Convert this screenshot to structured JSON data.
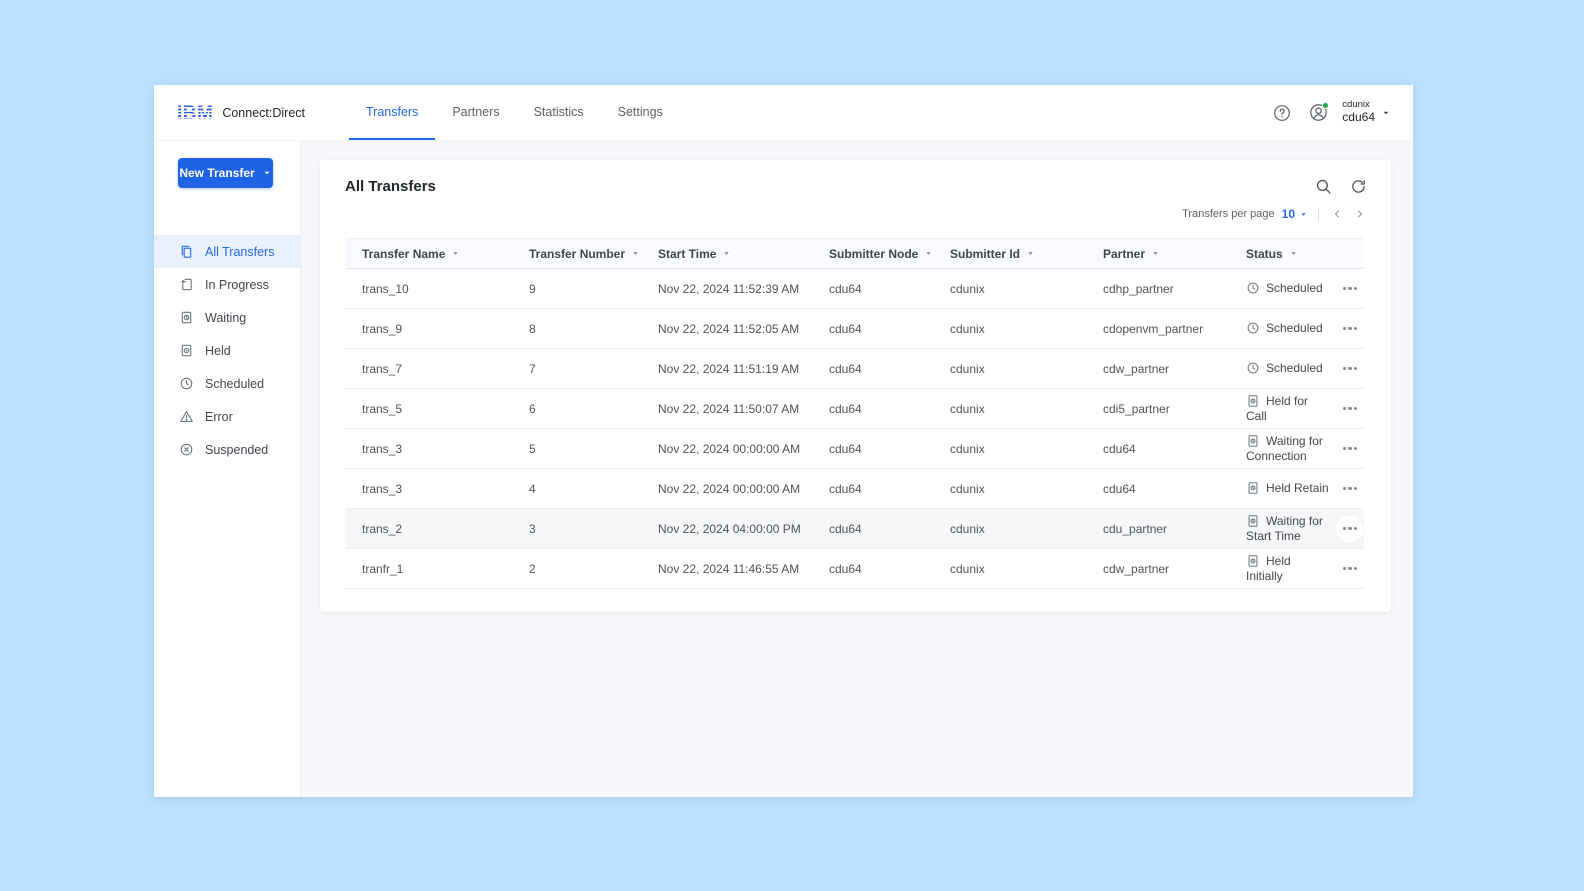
{
  "app": {
    "brand": {
      "logo": "IBM",
      "product": "Connect:Direct"
    },
    "nav_tabs": [
      {
        "label": "Transfers",
        "active": true
      },
      {
        "label": "Partners",
        "active": false
      },
      {
        "label": "Statistics",
        "active": false
      },
      {
        "label": "Settings",
        "active": false
      }
    ],
    "user": {
      "org": "cdunix",
      "name": "cdu64",
      "presence": "online"
    }
  },
  "sidebar": {
    "new_transfer_label": "New Transfer",
    "items": [
      {
        "label": "All Transfers",
        "icon": "all-transfers-icon",
        "active": true
      },
      {
        "label": "In Progress",
        "icon": "in-progress-icon",
        "active": false
      },
      {
        "label": "Waiting",
        "icon": "waiting-icon",
        "active": false
      },
      {
        "label": "Held",
        "icon": "held-icon",
        "active": false
      },
      {
        "label": "Scheduled",
        "icon": "scheduled-icon",
        "active": false
      },
      {
        "label": "Error",
        "icon": "error-icon",
        "active": false
      },
      {
        "label": "Suspended",
        "icon": "suspended-icon",
        "active": false
      }
    ]
  },
  "main": {
    "title": "All Transfers",
    "pagination": {
      "per_page_label": "Transfers per page",
      "per_page_value": "10"
    },
    "table": {
      "columns": [
        "Transfer Name",
        "Transfer Number",
        "Start Time",
        "Submitter Node",
        "Submitter Id",
        "Partner",
        "Status"
      ],
      "rows": [
        {
          "name": "trans_10",
          "number": "9",
          "start_time": "Nov 22, 2024 11:52:39 AM",
          "submitter_node": "cdu64",
          "submitter_id": "cdunix",
          "partner": "cdhp_partner",
          "status": "Scheduled",
          "status_icon": "clock-icon",
          "highlighted": false
        },
        {
          "name": "trans_9",
          "number": "8",
          "start_time": "Nov 22, 2024 11:52:05 AM",
          "submitter_node": "cdu64",
          "submitter_id": "cdunix",
          "partner": "cdopenvm_partner",
          "status": "Scheduled",
          "status_icon": "clock-icon",
          "highlighted": false
        },
        {
          "name": "trans_7",
          "number": "7",
          "start_time": "Nov 22, 2024 11:51:19 AM",
          "submitter_node": "cdu64",
          "submitter_id": "cdunix",
          "partner": "cdw_partner",
          "status": "Scheduled",
          "status_icon": "clock-icon",
          "highlighted": false
        },
        {
          "name": "trans_5",
          "number": "6",
          "start_time": "Nov 22, 2024 11:50:07 AM",
          "submitter_node": "cdu64",
          "submitter_id": "cdunix",
          "partner": "cdi5_partner",
          "status": "Held for Call",
          "status_icon": "held-doc-icon",
          "highlighted": false
        },
        {
          "name": "trans_3",
          "number": "5",
          "start_time": "Nov 22, 2024 00:00:00 AM",
          "submitter_node": "cdu64",
          "submitter_id": "cdunix",
          "partner": "cdu64",
          "status": "Waiting for Connection",
          "status_icon": "held-doc-icon",
          "highlighted": false
        },
        {
          "name": "trans_3",
          "number": "4",
          "start_time": "Nov 22, 2024 00:00:00 AM",
          "submitter_node": "cdu64",
          "submitter_id": "cdunix",
          "partner": "cdu64",
          "status": "Held Retain",
          "status_icon": "held-doc-icon",
          "highlighted": false
        },
        {
          "name": "trans_2",
          "number": "3",
          "start_time": "Nov 22, 2024 04:00:00 PM",
          "submitter_node": "cdu64",
          "submitter_id": "cdunix",
          "partner": "cdu_partner",
          "status": "Waiting for Start Time",
          "status_icon": "held-doc-icon",
          "highlighted": true
        },
        {
          "name": "tranfr_1",
          "number": "2",
          "start_time": "Nov 22, 2024 11:46:55 AM",
          "submitter_node": "cdu64",
          "submitter_id": "cdunix",
          "partner": "cdw_partner",
          "status": "Held Initially",
          "status_icon": "held-doc-icon",
          "highlighted": false
        }
      ]
    }
  },
  "colors": {
    "accent_blue": "#1f62e5",
    "active_item_bg": "#e9f1fd",
    "presence_green": "#24a148",
    "page_bg": "#bae2fc",
    "content_bg": "#f6f8fc"
  }
}
